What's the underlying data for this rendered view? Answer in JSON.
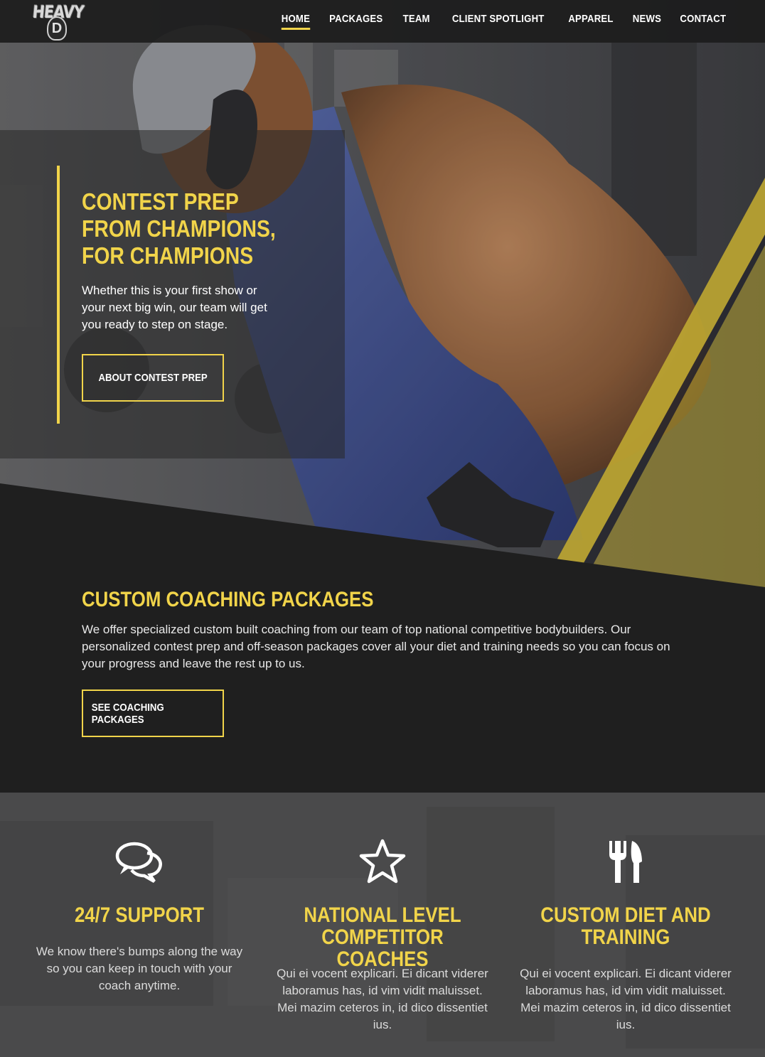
{
  "brand": {
    "logo_text": "HEAVY",
    "logo_mark": "D"
  },
  "nav": {
    "items": [
      {
        "label": "HOME",
        "active": true
      },
      {
        "label": "PACKAGES",
        "active": false
      },
      {
        "label": "TEAM",
        "active": false
      },
      {
        "label": "CLIENT SPOTLIGHT",
        "active": false
      },
      {
        "label": "APPAREL",
        "active": false
      },
      {
        "label": "NEWS",
        "active": false
      },
      {
        "label": "CONTACT",
        "active": false
      }
    ]
  },
  "hero": {
    "title": "CONTEST PREP FROM CHAMPIONS, FOR CHAMPIONS",
    "text": "Whether this is your first show or your next big win, our team will get you ready to step on stage.",
    "button_label": "ABOUT CONTEST PREP"
  },
  "packages": {
    "title": "CUSTOM COACHING PACKAGES",
    "text": "We offer specialized custom built coaching from our team of top national competitive bodybuilders. Our personalized contest prep and off-season packages cover all your diet and training needs so you can focus on your progress and leave the rest up to us.",
    "button_label": "SEE COACHING PACKAGES"
  },
  "features": [
    {
      "icon": "chat-bubbles-icon",
      "title": "24/7 SUPPORT",
      "text": "We know there's bumps along the way so you can keep in touch with your coach anytime."
    },
    {
      "icon": "star-icon",
      "title": "NATIONAL LEVEL COMPETITOR COACHES",
      "text": "Qui ei vocent explicari. Ei dicant viderer laboramus has, id vim vidit maluisset. Mei mazim ceteros in, id dico dissentiet ius."
    },
    {
      "icon": "fork-knife-icon",
      "title": "CUSTOM DIET AND TRAINING",
      "text": "Qui ei vocent explicari. Ei dicant viderer laboramus has, id vim vidit maluisset. Mei mazim ceteros in, id dico dissentiet ius."
    }
  ],
  "colors": {
    "accent": "#f1d44a",
    "dark": "#1f1f1f",
    "header": "#1c1c1c",
    "features_bg": "#4a4a4b"
  }
}
